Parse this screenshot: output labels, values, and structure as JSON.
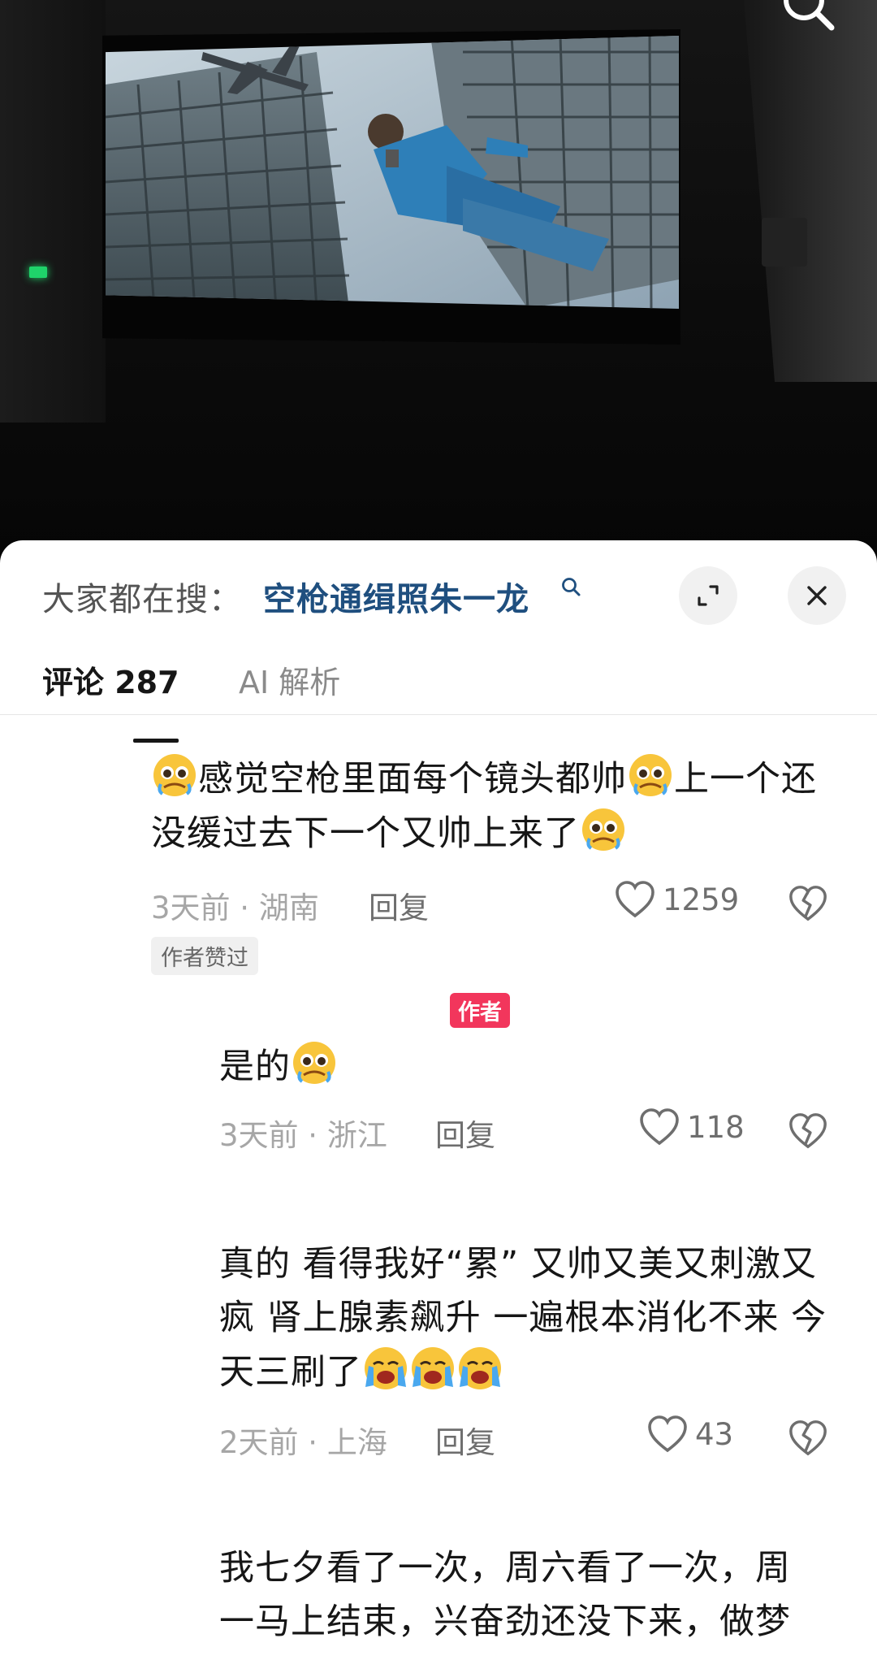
{
  "sheet": {
    "search_prefix": "大家都在搜：",
    "search_term": "空枪通缉照朱一龙",
    "tabs": [
      {
        "label": "评论 287",
        "active": true
      },
      {
        "label": "AI 解析",
        "active": false
      }
    ]
  },
  "comments": [
    {
      "text_parts": [
        "emoji:cry",
        "感觉空枪里面每个镜头都帅",
        "emoji:cry",
        "上一个还没缓过去下一个又帅上来了",
        "emoji:cry"
      ],
      "time_location": "3天前 · 湖南",
      "reply_label": "回复",
      "likes": "1259",
      "tag": "作者赞过"
    },
    {
      "author_badge": "作者",
      "text_parts": [
        "是的",
        "emoji:cry"
      ],
      "time_location": "3天前 · 浙江",
      "reply_label": "回复",
      "likes": "118"
    },
    {
      "text_parts": [
        "真的 看得我好“累” 又帅又美又刺激又疯 肾上腺素飙升 一遍根本消化不来 今天三刷了",
        "emoji:sob",
        "emoji:sob",
        "emoji:sob"
      ],
      "time_location": "2天前 · 上海",
      "reply_label": "回复",
      "likes": "43"
    },
    {
      "text_parts": [
        "我七夕看了一次，周六看了一次，周一马上结束，兴奋劲还没下来，做梦"
      ],
      "partial": true
    }
  ],
  "icons": {
    "top_search": "search-icon",
    "search_term": "search-icon",
    "expand": "expand-icon",
    "close": "close-icon",
    "like": "heart-outline-icon",
    "dislike": "broken-heart-icon"
  },
  "colors": {
    "search_term": "#1f4f7f",
    "author_badge": "#f2365c",
    "meta_text": "#a6a6a6"
  }
}
